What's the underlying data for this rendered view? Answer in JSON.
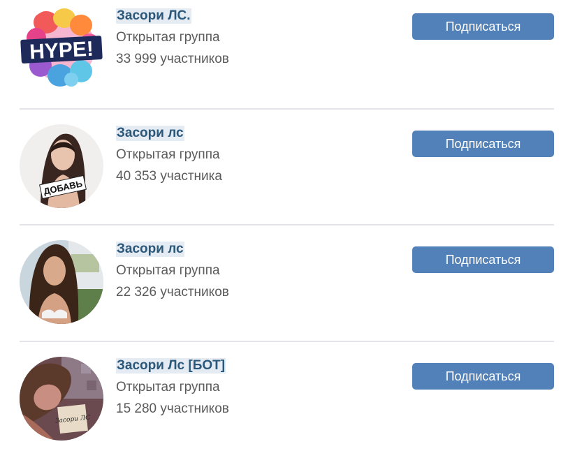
{
  "groups": [
    {
      "name": "Засори ЛС.",
      "type": "Открытая группа",
      "members": "33 999 участников",
      "button": "Подписаться",
      "avatar_icon": "hype-logo",
      "avatar_text": "HYPE!"
    },
    {
      "name": "Засори лс",
      "type": "Открытая группа",
      "members": "40 353 участника",
      "button": "Подписаться",
      "avatar_icon": "photo-with-sign",
      "avatar_text": "ДОБАВЬ"
    },
    {
      "name": "Засори лс",
      "type": "Открытая группа",
      "members": "22 326 участников",
      "button": "Подписаться",
      "avatar_icon": "photo"
    },
    {
      "name": "Засори Лс [БОТ]",
      "type": "Открытая группа",
      "members": "15 280 участников",
      "button": "Подписаться",
      "avatar_icon": "photo-with-sign",
      "avatar_text": "Засори ЛС"
    }
  ],
  "colors": {
    "link": "#2b587a",
    "highlight": "#e4ebf3",
    "button": "#5181b8",
    "muted_text": "#5b5b5b",
    "divider": "#e3e5e8"
  }
}
